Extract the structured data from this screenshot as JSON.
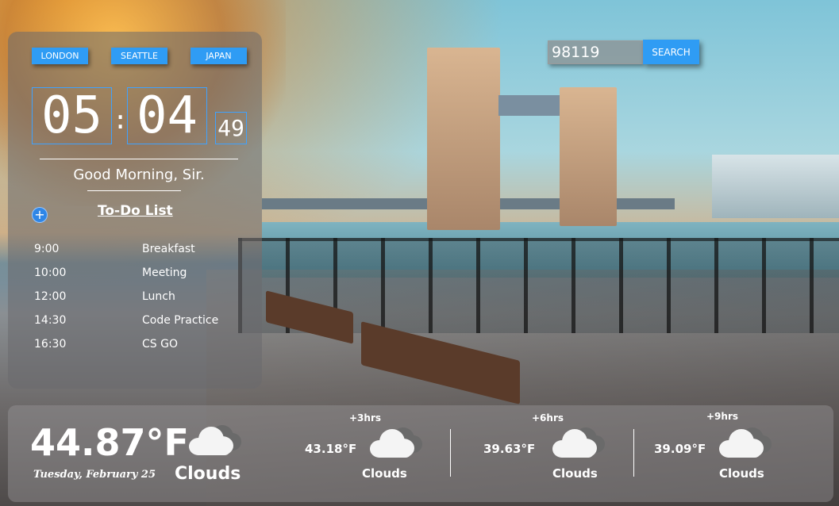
{
  "cities": {
    "london": "LONDON",
    "seattle": "SEATTLE",
    "japan": "JAPAN"
  },
  "clock": {
    "hours": "05",
    "separator": ":",
    "minutes": "04",
    "seconds": "49"
  },
  "greeting": "Good Morning, Sir.",
  "todo": {
    "add_label": "+",
    "title": "To-Do List",
    "items": [
      {
        "time": "9:00",
        "task": "Breakfast"
      },
      {
        "time": "10:00",
        "task": "Meeting"
      },
      {
        "time": "12:00",
        "task": "Lunch"
      },
      {
        "time": "14:30",
        "task": "Code Practice"
      },
      {
        "time": "16:30",
        "task": "CS GO"
      }
    ]
  },
  "search": {
    "value": "98119",
    "button_label": "SEARCH"
  },
  "weather": {
    "current": {
      "temp": "44.87°F",
      "date": "Tuesday, February 25",
      "condition": "Clouds",
      "icon": "cloud-icon"
    },
    "forecast": [
      {
        "offset": "+3hrs",
        "temp": "43.18°F",
        "condition": "Clouds",
        "icon": "cloud-icon"
      },
      {
        "offset": "+6hrs",
        "temp": "39.63°F",
        "condition": "Clouds",
        "icon": "cloud-icon"
      },
      {
        "offset": "+9hrs",
        "temp": "39.09°F",
        "condition": "Clouds",
        "icon": "cloud-icon"
      }
    ]
  },
  "colors": {
    "accent": "#2f9cf4",
    "clock_border": "#3fa2ff"
  }
}
